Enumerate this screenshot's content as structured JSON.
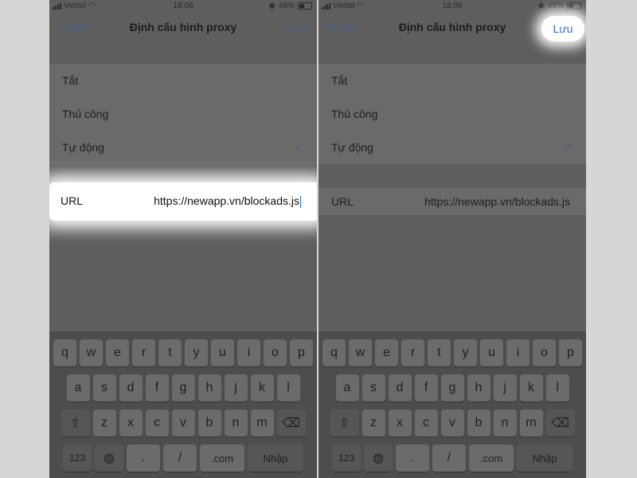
{
  "status": {
    "carrier": "Viettel",
    "time": "18:06",
    "battery": "49%"
  },
  "nav": {
    "back_label": "Putin",
    "title": "Định cấu hình proxy",
    "save_label": "Lưu"
  },
  "options": [
    {
      "label": "Tắt"
    },
    {
      "label": "Thủ công"
    },
    {
      "label": "Tự động",
      "checked": true
    }
  ],
  "url": {
    "label": "URL",
    "value": "https://newapp.vn/blockads.js"
  },
  "keyboard": {
    "row1": [
      "q",
      "w",
      "e",
      "r",
      "t",
      "y",
      "u",
      "i",
      "o",
      "p"
    ],
    "row2": [
      "a",
      "s",
      "d",
      "f",
      "g",
      "h",
      "j",
      "k",
      "l"
    ],
    "row3": [
      "z",
      "x",
      "c",
      "v",
      "b",
      "n",
      "m"
    ],
    "key_123": "123",
    "key_period": ".",
    "key_slash": "/",
    "key_com": ".com",
    "key_enter": "Nhập"
  },
  "icons": {
    "wifi": "wifi-icon",
    "back": "chevron-left-icon",
    "check": "checkmark-icon",
    "shift": "shift-icon",
    "delete": "backspace-icon",
    "globe": "globe-icon"
  }
}
